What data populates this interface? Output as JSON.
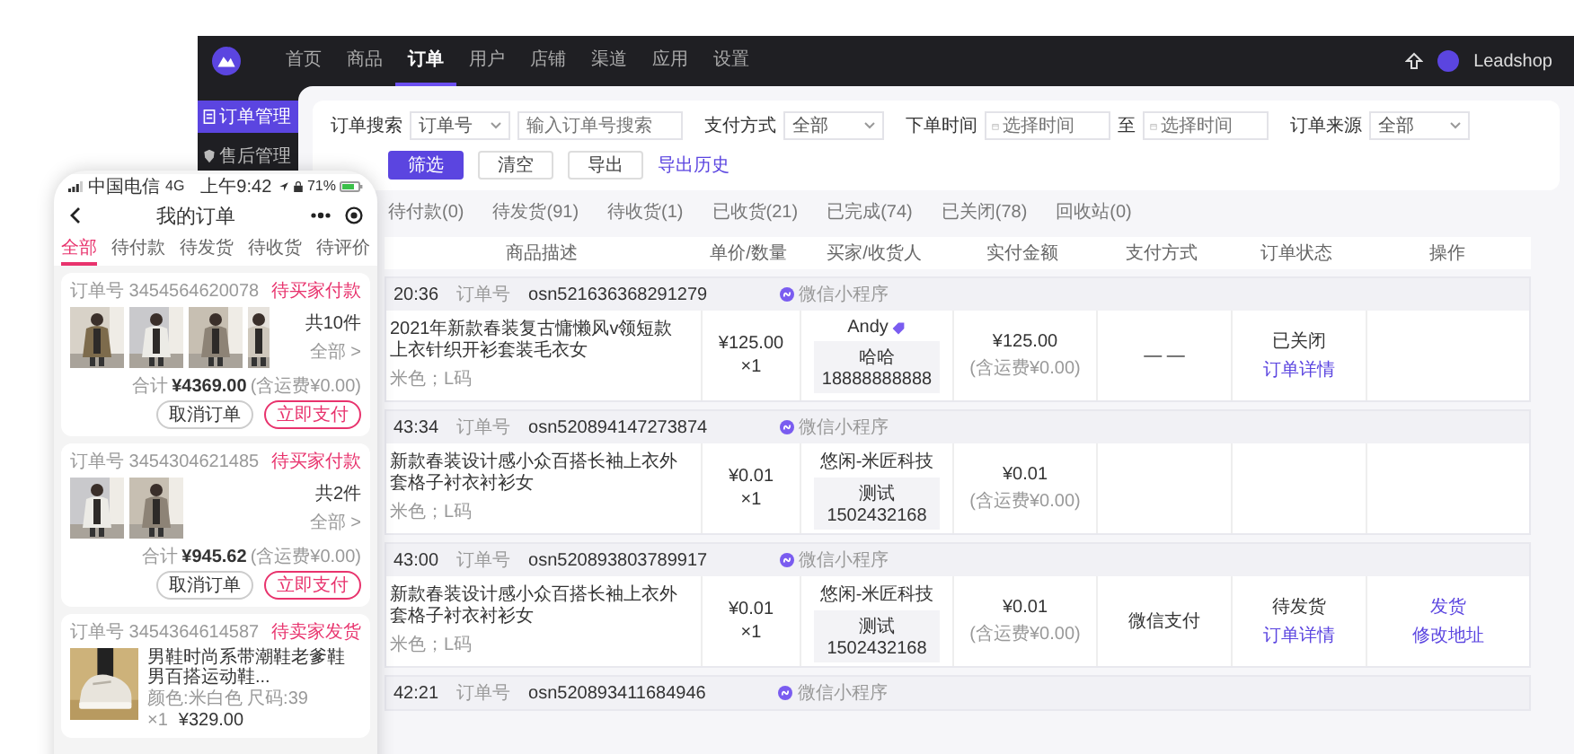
{
  "topbar": {
    "nav": [
      {
        "label": "首页",
        "selected": false
      },
      {
        "label": "商品",
        "selected": false
      },
      {
        "label": "订单",
        "selected": true
      },
      {
        "label": "用户",
        "selected": false
      },
      {
        "label": "店铺",
        "selected": false
      },
      {
        "label": "渠道",
        "selected": false
      },
      {
        "label": "应用",
        "selected": false
      },
      {
        "label": "设置",
        "selected": false
      }
    ],
    "user": "Leadshop"
  },
  "sidebar": {
    "items": [
      {
        "label": "订单管理",
        "selected": true
      },
      {
        "label": "售后管理",
        "selected": false
      }
    ]
  },
  "filters": {
    "fields": [
      {
        "kind": "select-input",
        "label": "订单搜索",
        "value": "订单号",
        "placeholder": "输入订单号搜索"
      },
      {
        "kind": "select",
        "label": "支付方式",
        "value": "全部"
      },
      {
        "kind": "daterange",
        "label": "下单时间",
        "placeholder": "选择时间",
        "separator": "至",
        "placeholder_end": "选择时间"
      },
      {
        "kind": "select",
        "label": "订单来源",
        "value": "全部"
      }
    ],
    "buttons": [
      {
        "kind": "primary",
        "label": "筛选"
      },
      {
        "kind": "default",
        "label": "清空"
      },
      {
        "kind": "default",
        "label": "导出"
      },
      {
        "kind": "link",
        "label": "导出历史"
      }
    ]
  },
  "status_tabs": [
    {
      "label": "待付款(0)",
      "selected": false
    },
    {
      "label": "待发货(91)",
      "selected": false
    },
    {
      "label": "待收货(1)",
      "selected": false
    },
    {
      "label": "已收货(21)",
      "selected": false
    },
    {
      "label": "已完成(74)",
      "selected": false
    },
    {
      "label": "已关闭(78)",
      "selected": false
    },
    {
      "label": "回收站(0)",
      "selected": false
    }
  ],
  "table": {
    "columns": [
      "商品描述",
      "单价/数量",
      "买家/收货人",
      "实付金额",
      "支付方式",
      "订单状态",
      "操作"
    ],
    "orders": [
      {
        "time": "20:36",
        "order_no_label": "订单号",
        "order_no": "osn521636368291279",
        "source": "微信小程序",
        "title_lines": [
          "2021年新款春装复古慵懒风v领短款",
          "上衣针织开衫套装毛衣女"
        ],
        "spec": "米色；L码",
        "price": "¥125.00",
        "quantity": "×1",
        "buyer": "Andy",
        "buyer_badge": true,
        "receiver": "哈哈",
        "phone": "18888888888",
        "amount": "¥125.00",
        "shipping": "(含运费¥0.00)",
        "payment": "— —",
        "status": "已关闭",
        "detail_link": "订单详情"
      },
      {
        "time": "43:34",
        "order_no_label": "订单号",
        "order_no": "osn520894147273874",
        "source": "微信小程序",
        "title_lines": [
          "新款春装设计感小众百搭长袖上衣外",
          "套格子衬衣衬衫女"
        ],
        "spec": "米色；L码",
        "price": "¥0.01",
        "quantity": "×1",
        "buyer": "悠闲-米匠科技",
        "buyer_badge": false,
        "receiver": "测试",
        "phone": "1502432168",
        "amount": "¥0.01",
        "shipping": "(含运费¥0.00)"
      },
      {
        "time": "43:00",
        "order_no_label": "订单号",
        "order_no": "osn520893803789917",
        "source": "微信小程序",
        "title_lines": [
          "新款春装设计感小众百搭长袖上衣外",
          "套格子衬衣衬衫女"
        ],
        "spec": "米色；L码",
        "price": "¥0.01",
        "quantity": "×1",
        "buyer": "悠闲-米匠科技",
        "buyer_badge": false,
        "receiver": "测试",
        "phone": "1502432168",
        "amount": "¥0.01",
        "shipping": "(含运费¥0.00)",
        "payment": "微信支付",
        "status": "待发货",
        "detail_link": "订单详情",
        "actions": [
          "发货",
          "修改地址"
        ]
      },
      {
        "time": "42:21",
        "order_no_label": "订单号",
        "order_no": "osn520893411684946",
        "source": "微信小程序"
      }
    ]
  },
  "phone": {
    "status_bar": {
      "carrier": "中国电信",
      "network": "4G",
      "time": "上午9:42",
      "battery": "71%"
    },
    "title": "我的订单",
    "tabs": [
      {
        "label": "全部",
        "selected": true
      },
      {
        "label": "待付款",
        "selected": false
      },
      {
        "label": "待发货",
        "selected": false
      },
      {
        "label": "待收货",
        "selected": false
      },
      {
        "label": "待评价",
        "selected": false
      }
    ],
    "orders": [
      {
        "kind": "multi",
        "number": "订单号 3454564620078",
        "status": "待买家付款",
        "pictures": [
          {
            "kind": "picture"
          },
          {
            "kind": "picture"
          },
          {
            "kind": "picture"
          },
          {
            "kind": "picture"
          }
        ],
        "count": "共10件",
        "all": "全部 >",
        "total_label": "合计",
        "total": "¥4369.00",
        "shipping": "(含运费¥0.00)",
        "buttons": [
          {
            "kind": "default",
            "label": "取消订单"
          },
          {
            "kind": "primary",
            "label": "立即支付"
          }
        ]
      },
      {
        "kind": "multi",
        "number": "订单号 3454304621485",
        "status": "待买家付款",
        "pictures": [
          {
            "kind": "picture"
          },
          {
            "kind": "picture"
          }
        ],
        "count": "共2件",
        "all": "全部 >",
        "total_label": "合计",
        "total": "¥945.62",
        "shipping": "(含运费¥0.00)",
        "buttons": [
          {
            "kind": "default",
            "label": "取消订单"
          },
          {
            "kind": "primary",
            "label": "立即支付"
          }
        ]
      },
      {
        "kind": "single",
        "number": "订单号 3454364614587",
        "status": "待卖家发货",
        "title": "男鞋时尚系带潮鞋老爹鞋男百搭运动鞋...",
        "spec": "颜色:米白色 尺码:39",
        "quantity": "×1",
        "price": "¥329.00"
      }
    ]
  }
}
